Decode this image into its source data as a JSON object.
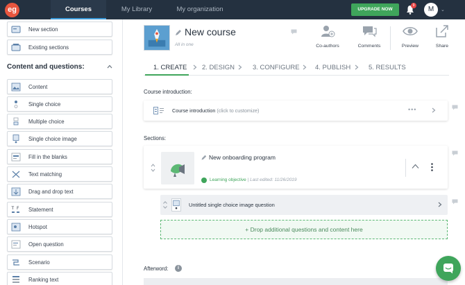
{
  "topbar": {
    "logo": "eg",
    "tabs": [
      {
        "label": "Courses",
        "active": true
      },
      {
        "label": "My Library",
        "active": false
      },
      {
        "label": "My organization",
        "active": false
      }
    ],
    "upgrade_label": "UPGRADE NOW",
    "notification_count": "9",
    "avatar_initial": "M",
    "caret": "⌄"
  },
  "sidebar": {
    "top_items": [
      {
        "label": "New section",
        "icon": "new-section-icon"
      },
      {
        "label": "Existing sections",
        "icon": "existing-sections-icon"
      }
    ],
    "heading": "Content and questions:",
    "items": [
      {
        "label": "Content",
        "icon": "content-icon"
      },
      {
        "label": "Single choice",
        "icon": "single-choice-icon"
      },
      {
        "label": "Multiple choice",
        "icon": "multiple-choice-icon"
      },
      {
        "label": "Single choice image",
        "icon": "single-choice-image-icon"
      },
      {
        "label": "Fill in the blanks",
        "icon": "fill-blanks-icon"
      },
      {
        "label": "Text matching",
        "icon": "text-matching-icon"
      },
      {
        "label": "Drag and drop text",
        "icon": "drag-drop-text-icon"
      },
      {
        "label": "Statement",
        "icon": "statement-icon"
      },
      {
        "label": "Hotspot",
        "icon": "hotspot-icon"
      },
      {
        "label": "Open question",
        "icon": "open-question-icon"
      },
      {
        "label": "Scenario",
        "icon": "scenario-icon"
      },
      {
        "label": "Ranking text",
        "icon": "ranking-text-icon"
      }
    ]
  },
  "course": {
    "title": "New course",
    "subtitle": "All in one",
    "actions": [
      {
        "label": "Co-authors",
        "icon": "co-authors-icon"
      },
      {
        "label": "Comments",
        "icon": "comments-icon"
      },
      {
        "label": "Preview",
        "icon": "preview-icon"
      },
      {
        "label": "Share",
        "icon": "share-icon"
      }
    ]
  },
  "steps": [
    {
      "label": "1. CREATE",
      "active": true
    },
    {
      "label": "2. DESIGN",
      "active": false
    },
    {
      "label": "3. CONFIGURE",
      "active": false
    },
    {
      "label": "4. PUBLISH",
      "active": false
    },
    {
      "label": "5. RESULTS",
      "active": false
    }
  ],
  "main": {
    "intro_heading": "Course introduction:",
    "intro_card": {
      "title": "Course introduction",
      "hint": "(click to customize)",
      "dots": "•••"
    },
    "sections_heading": "Sections:",
    "section": {
      "title": "New onboarding program",
      "objective": "Learning objective",
      "edited": "| Last edited: 11/26/2019"
    },
    "question": {
      "title": "Untitled single choice image question"
    },
    "drop_zone": "+ Drop additional questions and content here",
    "afterword_heading": "Afterword:",
    "info_glyph": "i"
  },
  "colors": {
    "topbar": "#243140",
    "accent_green": "#3fa55b",
    "active_tab_underline": "#3b9ad9",
    "logo": "#e8563f"
  }
}
